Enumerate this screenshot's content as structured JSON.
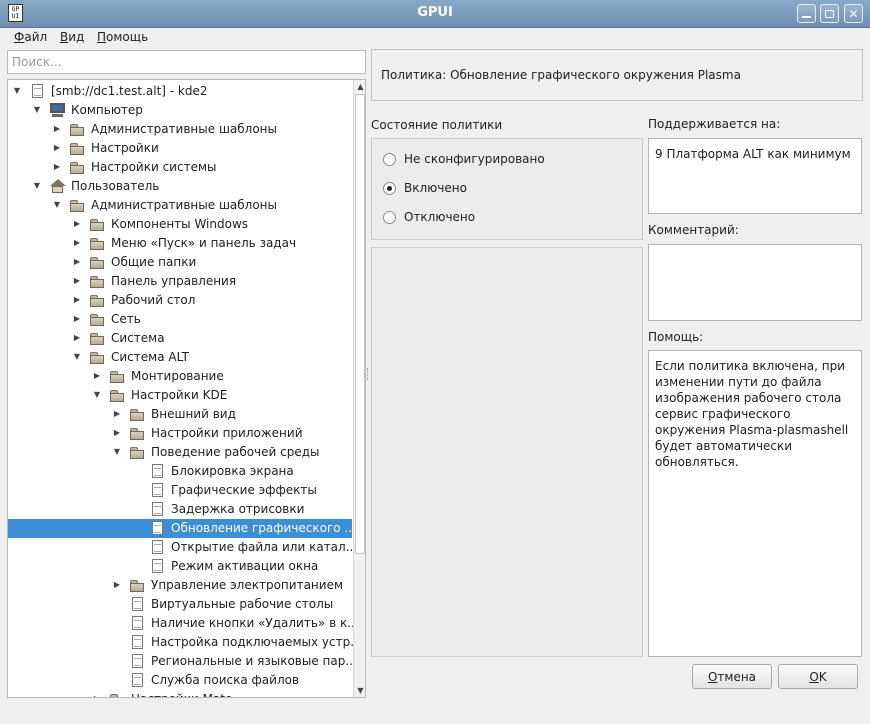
{
  "window": {
    "title": "GPUI",
    "icon_text": "GP UI"
  },
  "menu": [
    {
      "first": "Ф",
      "rest": "айл"
    },
    {
      "first": "В",
      "rest": "ид"
    },
    {
      "first": "П",
      "rest": "омощь"
    }
  ],
  "search": {
    "placeholder": "Поиск...",
    "value": ""
  },
  "tree": [
    {
      "label": "[smb://dc1.test.alt] - kde2",
      "depth": 0,
      "icon": "doc",
      "arrow": "down"
    },
    {
      "label": "Компьютер",
      "depth": 1,
      "icon": "computer",
      "arrow": "down"
    },
    {
      "label": "Административные шаблоны",
      "depth": 2,
      "icon": "folder",
      "arrow": "right"
    },
    {
      "label": "Настройки",
      "depth": 2,
      "icon": "folder",
      "arrow": "right"
    },
    {
      "label": "Настройки системы",
      "depth": 2,
      "icon": "folder",
      "arrow": "right"
    },
    {
      "label": "Пользователь",
      "depth": 1,
      "icon": "house",
      "arrow": "down"
    },
    {
      "label": "Административные шаблоны",
      "depth": 2,
      "icon": "folder",
      "arrow": "down"
    },
    {
      "label": "Компоненты Windows",
      "depth": 3,
      "icon": "folder",
      "arrow": "right"
    },
    {
      "label": "Меню «Пуск» и панель задач",
      "depth": 3,
      "icon": "folder",
      "arrow": "right"
    },
    {
      "label": "Общие папки",
      "depth": 3,
      "icon": "folder",
      "arrow": "right"
    },
    {
      "label": "Панель управления",
      "depth": 3,
      "icon": "folder",
      "arrow": "right"
    },
    {
      "label": "Рабочий стол",
      "depth": 3,
      "icon": "folder",
      "arrow": "right"
    },
    {
      "label": "Сеть",
      "depth": 3,
      "icon": "folder",
      "arrow": "right"
    },
    {
      "label": "Система",
      "depth": 3,
      "icon": "folder",
      "arrow": "right"
    },
    {
      "label": "Система ALT",
      "depth": 3,
      "icon": "folder",
      "arrow": "down"
    },
    {
      "label": "Монтирование",
      "depth": 4,
      "icon": "folder",
      "arrow": "right"
    },
    {
      "label": "Настройки KDE",
      "depth": 4,
      "icon": "folder",
      "arrow": "down"
    },
    {
      "label": "Внешний вид",
      "depth": 5,
      "icon": "folder",
      "arrow": "right"
    },
    {
      "label": "Настройки приложений",
      "depth": 5,
      "icon": "folder",
      "arrow": "right"
    },
    {
      "label": "Поведение рабочей среды",
      "depth": 5,
      "icon": "folder",
      "arrow": "down"
    },
    {
      "label": "Блокировка экрана",
      "depth": 6,
      "icon": "doc",
      "arrow": ""
    },
    {
      "label": "Графические эффекты",
      "depth": 6,
      "icon": "doc",
      "arrow": ""
    },
    {
      "label": "Задержка отрисовки",
      "depth": 6,
      "icon": "doc",
      "arrow": ""
    },
    {
      "label": "Обновление графического ...",
      "depth": 6,
      "icon": "doc",
      "arrow": "",
      "selected": true
    },
    {
      "label": "Открытие файла или катал...",
      "depth": 6,
      "icon": "doc",
      "arrow": ""
    },
    {
      "label": "Режим активации окна",
      "depth": 6,
      "icon": "doc",
      "arrow": ""
    },
    {
      "label": "Управление электропитанием",
      "depth": 5,
      "icon": "folder",
      "arrow": "right"
    },
    {
      "label": "Виртуальные рабочие столы",
      "depth": 5,
      "icon": "doc",
      "arrow": ""
    },
    {
      "label": "Наличие кнопки «Удалить» в к...",
      "depth": 5,
      "icon": "doc",
      "arrow": ""
    },
    {
      "label": "Настройка подключаемых устр...",
      "depth": 5,
      "icon": "doc",
      "arrow": ""
    },
    {
      "label": "Региональные и языковые пар...",
      "depth": 5,
      "icon": "doc",
      "arrow": ""
    },
    {
      "label": "Служба поиска файлов",
      "depth": 5,
      "icon": "doc",
      "arrow": ""
    },
    {
      "label": "Настройки Mate",
      "depth": 4,
      "icon": "folder",
      "arrow": "right"
    }
  ],
  "policy": {
    "title": "Политика: Обновление графического окружения Plasma",
    "state_label": "Состояние политики",
    "states": [
      {
        "label": "Не сконфигурировано",
        "checked": false
      },
      {
        "label": "Включено",
        "checked": true
      },
      {
        "label": "Отключено",
        "checked": false
      }
    ],
    "supported_label": "Поддерживается на:",
    "supported_value": "9 Платформа ALT как минимум",
    "comment_label": "Комментарий:",
    "comment_value": "",
    "help_label": "Помощь:",
    "help_value": "Если политика включена, при изменении пути до файла изображения рабочего стола сервис графического окружения Plasma-plasmashell будет автоматически обновляться."
  },
  "buttons": {
    "cancel": {
      "first": "О",
      "rest": "тмена"
    },
    "ok": {
      "first": "O",
      "rest": "K"
    }
  }
}
